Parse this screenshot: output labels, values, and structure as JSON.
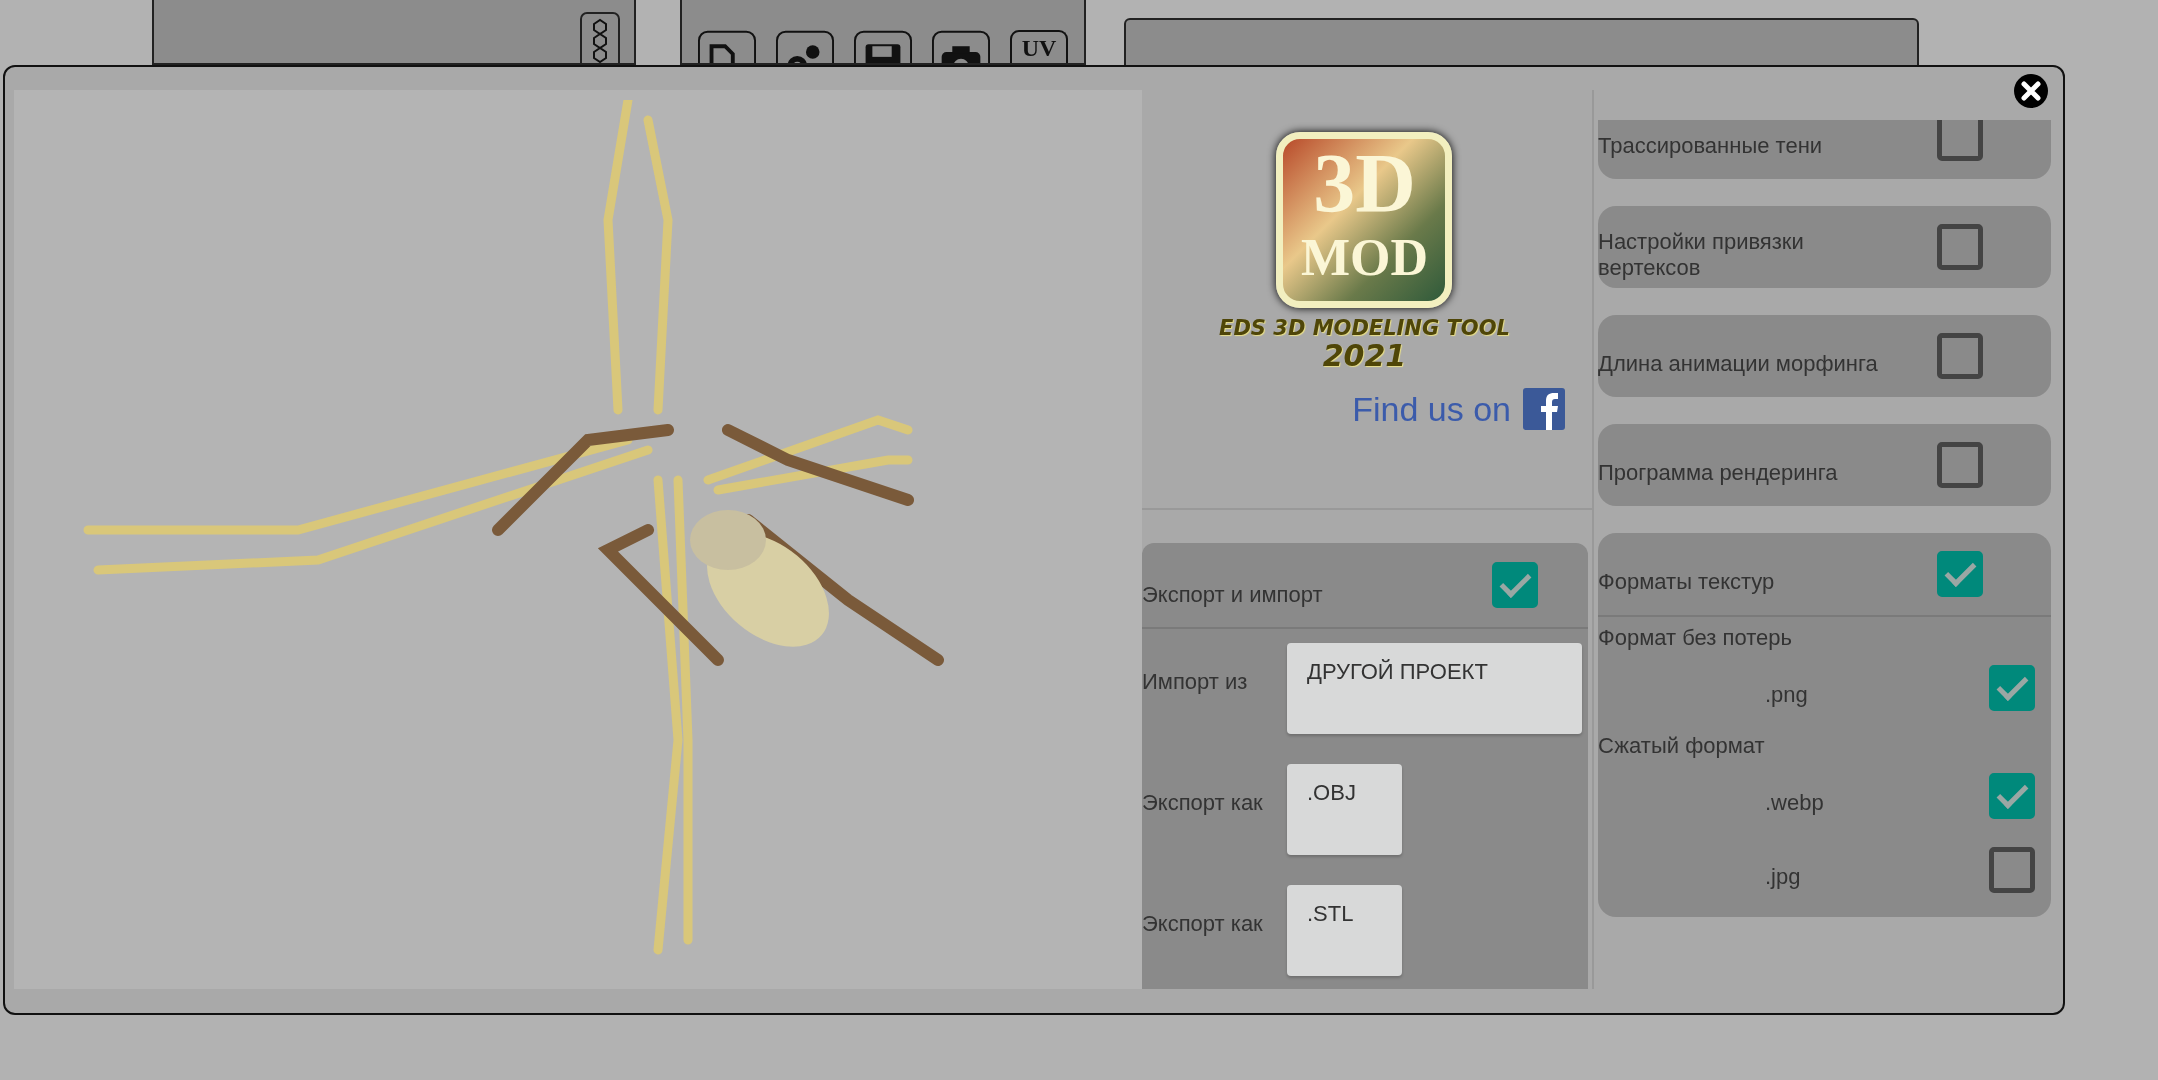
{
  "background_toolbar": {
    "uv_button": "UV"
  },
  "logo": {
    "line1": "3D",
    "line2": "MOD",
    "subtitle": "EDS 3D MODELING TOOL",
    "year": "2021"
  },
  "facebook_link": {
    "label": "Find us on"
  },
  "export_import": {
    "label": "Экспорт и импорт",
    "checked": true,
    "rows": [
      {
        "label": "Импорт из",
        "value": "ДРУГОЙ ПРОЕКТ",
        "kind": "wide"
      },
      {
        "label": "Экспорт как",
        "value": ".OBJ",
        "kind": "narrow"
      },
      {
        "label": "Экспорт как",
        "value": ".STL",
        "kind": "narrow"
      }
    ]
  },
  "settings": [
    {
      "label": "Трассированные тени",
      "checked": false
    },
    {
      "label": "Настройки привязки вертексов",
      "checked": false
    },
    {
      "label": "Длина анимации морфинга",
      "checked": false
    },
    {
      "label": "Программа рендеринга",
      "checked": false
    },
    {
      "label": "Форматы текстур",
      "checked": true,
      "groups": [
        {
          "label": "Формат без потерь",
          "options": [
            {
              "label": ".png",
              "checked": true
            }
          ]
        },
        {
          "label": "Сжатый формат",
          "options": [
            {
              "label": ".webp",
              "checked": true
            },
            {
              "label": ".jpg",
              "checked": false
            }
          ]
        }
      ]
    }
  ]
}
